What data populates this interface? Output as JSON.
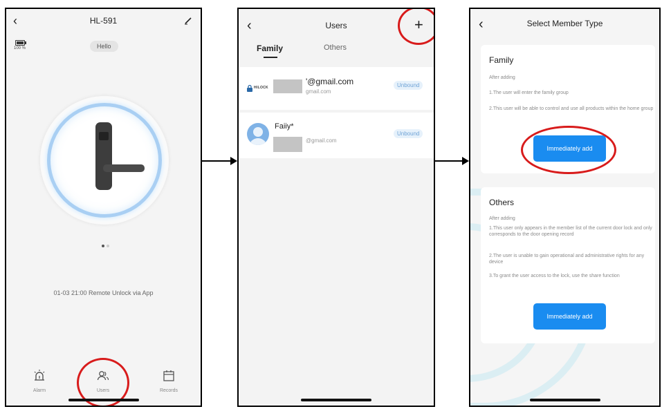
{
  "phone1": {
    "title": "HL-591",
    "battery": "100 %",
    "greeting": "Hello",
    "status": "01-03 21:00  Remote Unlock via App",
    "tabs": [
      {
        "label": "Alarm",
        "icon": "alarm-icon"
      },
      {
        "label": "Users",
        "icon": "users-icon"
      },
      {
        "label": "Records",
        "icon": "calendar-icon"
      }
    ],
    "pager_active_color": "#555555",
    "pager_inactive_color": "#cccccc"
  },
  "phone2": {
    "title": "Users",
    "add_label": "+",
    "tabs": {
      "family": "Family",
      "others": "Others"
    },
    "users": [
      {
        "logo": "HILOCK",
        "email_main": "'@gmail.com",
        "email_sub": "gmail.com",
        "badge": "Unbound"
      },
      {
        "name": "Faiiy*",
        "email_sub": "@gmail.com",
        "badge": "Unbound"
      }
    ]
  },
  "phone3": {
    "title": "Select Member Type",
    "family": {
      "title": "Family",
      "lines": [
        "After adding",
        "1.The user will enter the family group",
        "2.This user will be able to control and use all products within the home group"
      ],
      "button": "Immediately add"
    },
    "others": {
      "title": "Others",
      "lines": [
        "After adding",
        "1.This user only appears in the member list of the current door lock and only corresponds to the door opening record",
        "2.The user is unable to gain operational and administrative rights for any device",
        "3.To grant the user access to the lock, use the share function"
      ],
      "button": "Immediately add"
    }
  },
  "colors": {
    "accent": "#1a8cf0",
    "highlight": "#d81b1b",
    "badge_text": "#6fa3d6",
    "ring": "#a9cff3"
  }
}
